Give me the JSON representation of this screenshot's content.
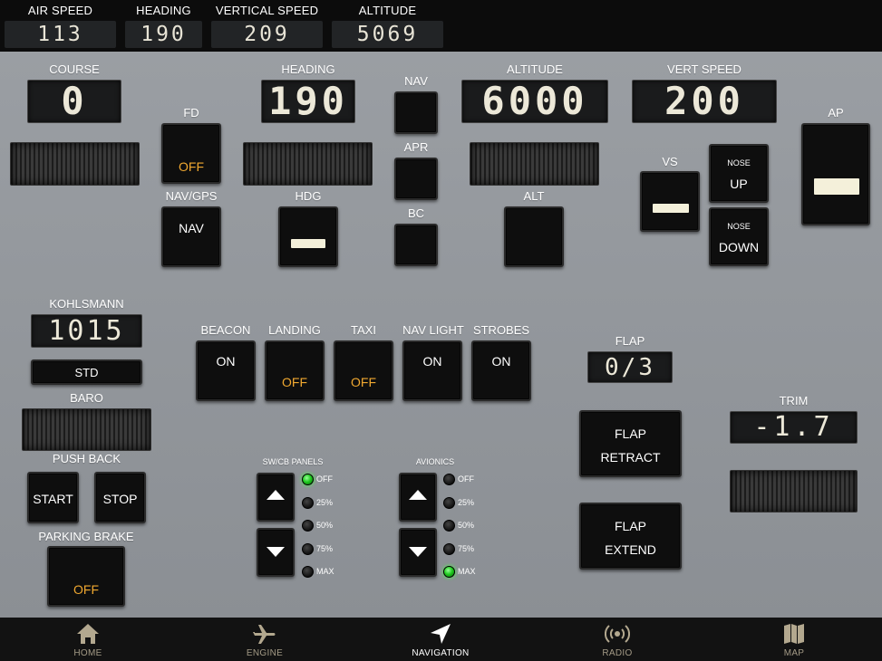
{
  "topbar": {
    "airspeed": {
      "label": "AIR SPEED",
      "value": "113"
    },
    "heading": {
      "label": "HEADING",
      "value": "190"
    },
    "vspeed": {
      "label": "VERTICAL SPEED",
      "value": "209"
    },
    "altitude": {
      "label": "ALTITUDE",
      "value": "5069"
    }
  },
  "autopilot": {
    "course": {
      "label": "COURSE",
      "value": "0"
    },
    "heading": {
      "label": "HEADING",
      "value": "190"
    },
    "altitude": {
      "label": "ALTITUDE",
      "value": "6000"
    },
    "vert_speed": {
      "label": "VERT SPEED",
      "value": "200"
    },
    "fd": {
      "label": "FD",
      "state": "OFF"
    },
    "navgps": {
      "label": "NAV/GPS",
      "state": "NAV"
    },
    "hdg": {
      "label": "HDG"
    },
    "nav": {
      "label": "NAV"
    },
    "apr": {
      "label": "APR"
    },
    "bc": {
      "label": "BC"
    },
    "alt": {
      "label": "ALT"
    },
    "vs": {
      "label": "VS"
    },
    "nose_up": {
      "small": "NOSE",
      "label": "UP"
    },
    "nose_down": {
      "small": "NOSE",
      "label": "DOWN"
    },
    "ap": {
      "label": "AP"
    }
  },
  "baro": {
    "kohlsmann_label": "KOHLSMANN",
    "kohlsmann_value": "1015",
    "std_label": "STD",
    "baro_label": "BARO"
  },
  "pushback": {
    "label": "PUSH BACK",
    "start": "START",
    "stop": "STOP"
  },
  "parking_brake": {
    "label": "PARKING BRAKE",
    "state": "OFF"
  },
  "lights": {
    "beacon": {
      "label": "BEACON",
      "state": "ON"
    },
    "landing": {
      "label": "LANDING",
      "state": "OFF"
    },
    "taxi": {
      "label": "TAXI",
      "state": "OFF"
    },
    "navlight": {
      "label": "NAV LIGHT",
      "state": "ON"
    },
    "strobes": {
      "label": "STROBES",
      "state": "ON"
    }
  },
  "swcb": {
    "label": "SW/CB PANELS",
    "levels": [
      "OFF",
      "25%",
      "50%",
      "75%",
      "MAX"
    ],
    "active": "OFF"
  },
  "avionics": {
    "label": "AVIONICS",
    "levels": [
      "OFF",
      "25%",
      "50%",
      "75%",
      "MAX"
    ],
    "active": "MAX"
  },
  "flap": {
    "label": "FLAP",
    "value": "0/3",
    "retract_1": "FLAP",
    "retract_2": "RETRACT",
    "extend_1": "FLAP",
    "extend_2": "EXTEND"
  },
  "trim": {
    "label": "TRIM",
    "value": "-1.7"
  },
  "nav": {
    "items": [
      {
        "label": "HOME",
        "icon": "home-icon"
      },
      {
        "label": "ENGINE",
        "icon": "airplane-icon"
      },
      {
        "label": "NAVIGATION",
        "icon": "navigation-arrow-icon"
      },
      {
        "label": "RADIO",
        "icon": "radio-broadcast-icon"
      },
      {
        "label": "MAP",
        "icon": "map-icon"
      }
    ],
    "active": "NAVIGATION"
  },
  "colors": {
    "off_state": "#f0a830",
    "panel_bg": "#8e9196",
    "led_green": "#2c2"
  }
}
